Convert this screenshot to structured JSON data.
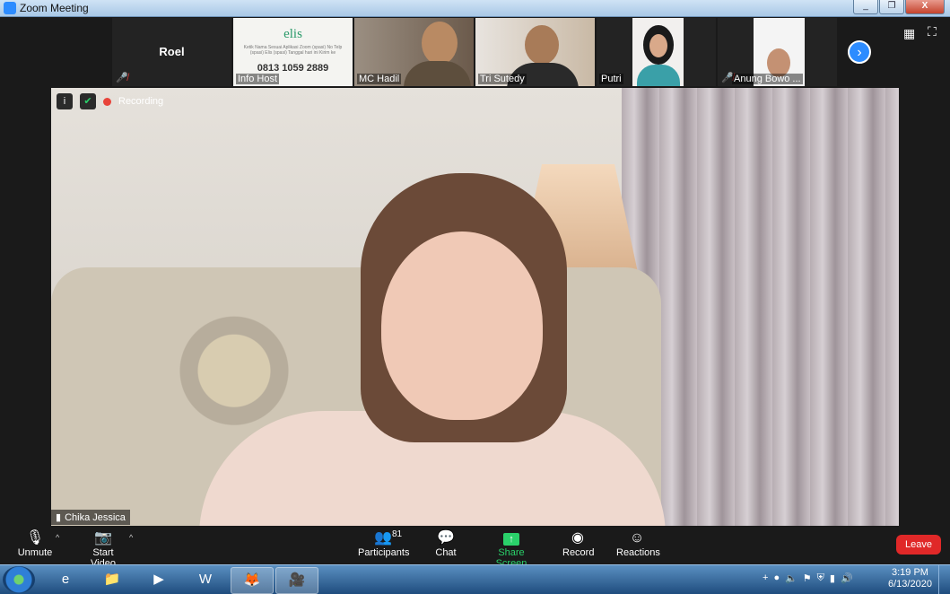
{
  "window": {
    "title": "Zoom Meeting",
    "buttons": [
      "_",
      "❐",
      "X"
    ]
  },
  "thumbnails": [
    {
      "name": "Roel",
      "muted": true
    },
    {
      "name": "Info Host",
      "screen_text": "elis",
      "screen_sub": "Ketik Nama Sesuai Aplikasi Zoom (spasi) No Telp (spasi) Elis (spasi) Tanggal hari ini Kirim ke",
      "screen_phone": "0813 1059 2889"
    },
    {
      "name": "MC Hadil"
    },
    {
      "name": "Tri Sutedy"
    },
    {
      "name": "Putri"
    },
    {
      "name": "Anung Bowo ...",
      "muted": true
    }
  ],
  "recording_label": "Recording",
  "active_speaker": "Chika Jessica",
  "toolbar": {
    "unmute": "Unmute",
    "start_video": "Start Video",
    "participants": "Participants",
    "participants_count": "81",
    "chat": "Chat",
    "share_screen": "Share Screen",
    "record": "Record",
    "reactions": "Reactions",
    "leave": "Leave"
  },
  "taskbar": {
    "time": "3:19 PM",
    "date": "6/13/2020"
  },
  "colors": {
    "accent": "#2d8cff",
    "share": "#2ad16a",
    "leave": "#e02828"
  }
}
